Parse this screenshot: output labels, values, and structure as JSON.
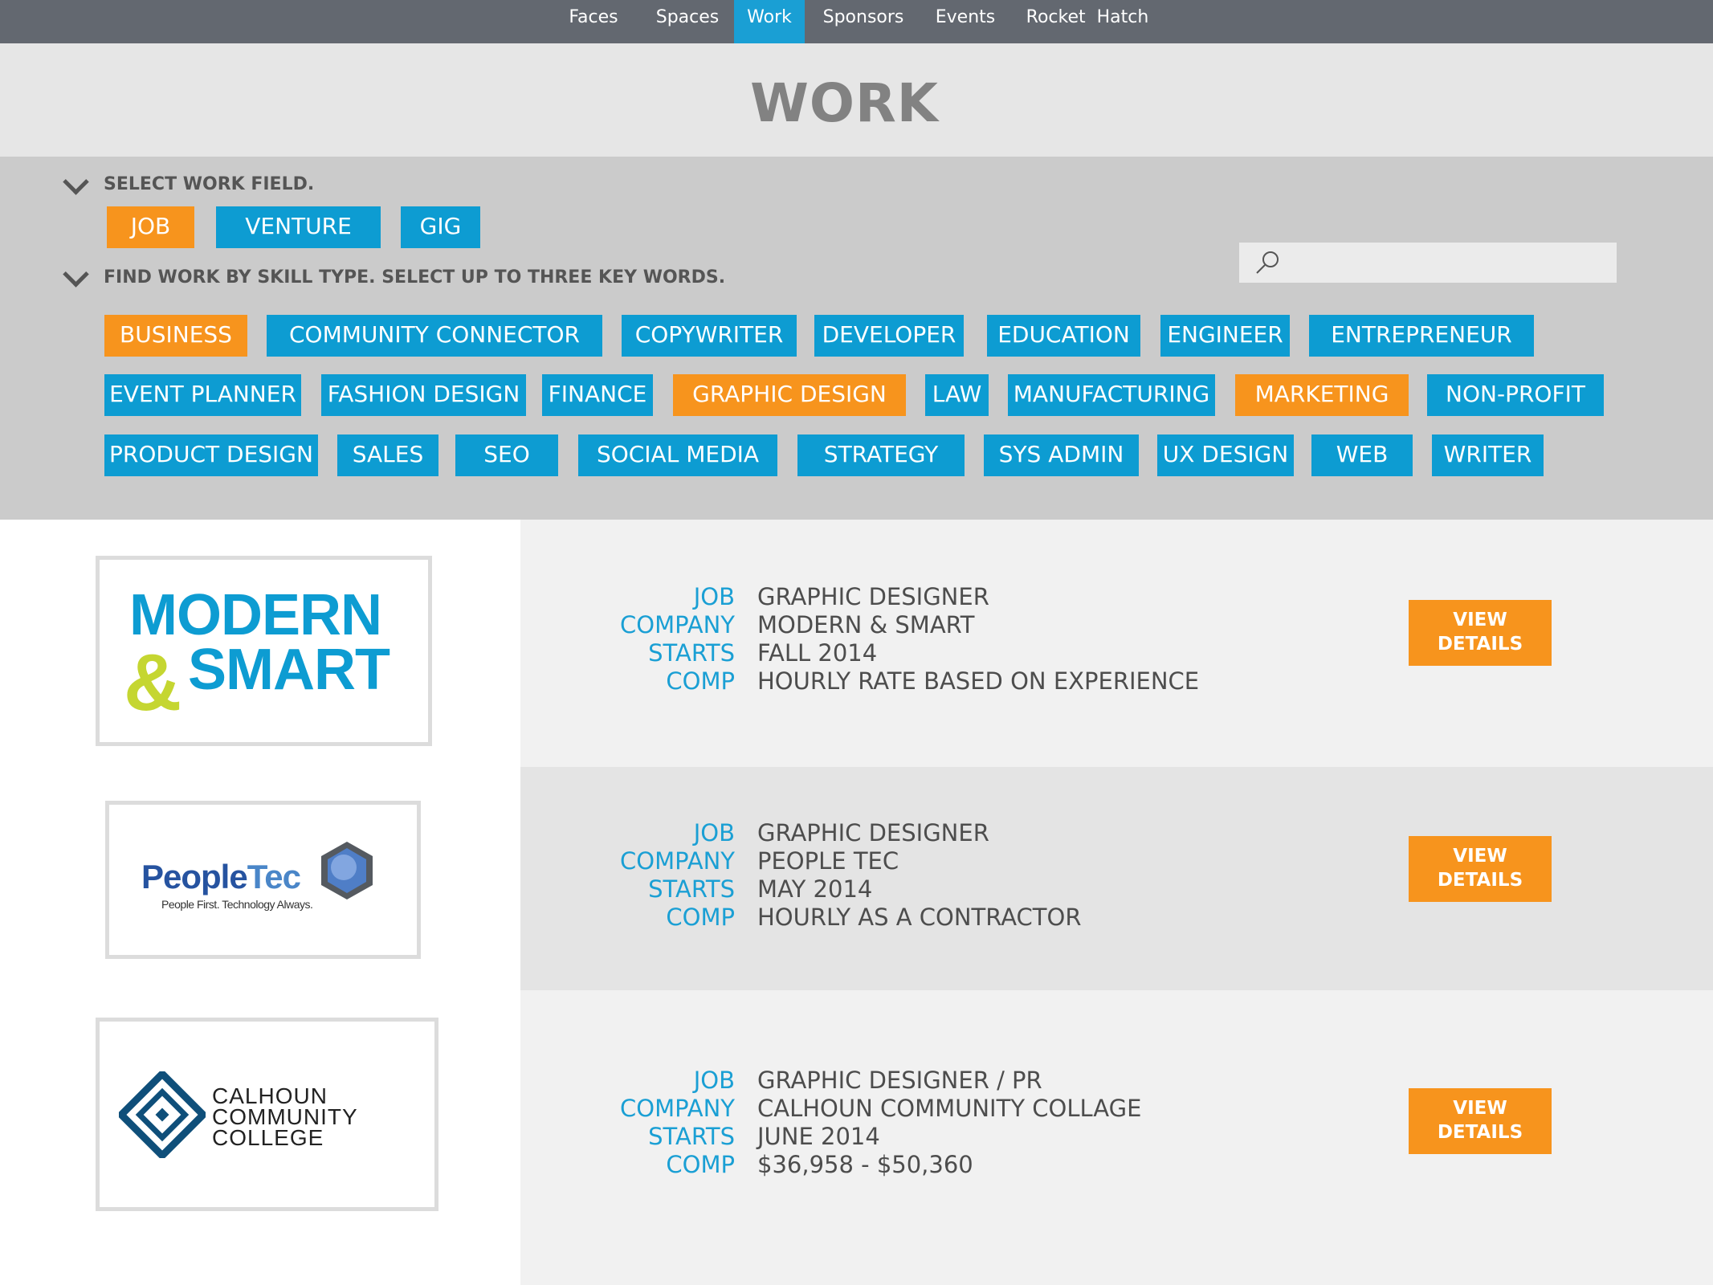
{
  "nav": {
    "items": [
      {
        "label": "Faces"
      },
      {
        "label": "Spaces"
      },
      {
        "label": "Work",
        "active": true
      },
      {
        "label": "Sponsors"
      },
      {
        "label": "Events"
      },
      {
        "label": "Rocket  Hatch"
      }
    ]
  },
  "page": {
    "title": "WORK"
  },
  "filters": {
    "field_label": "SELECT WORK FIELD.",
    "field_options": [
      {
        "label": "JOB",
        "selected": true
      },
      {
        "label": "VENTURE",
        "selected": false
      },
      {
        "label": "GIG",
        "selected": false
      }
    ],
    "skill_label": "FIND WORK BY SKILL TYPE. SELECT UP TO THREE KEY WORDS.",
    "search": {
      "placeholder": "",
      "value": ""
    },
    "skills": [
      {
        "label": "BUSINESS",
        "selected": true
      },
      {
        "label": "COMMUNITY CONNECTOR",
        "selected": false
      },
      {
        "label": "COPYWRITER",
        "selected": false
      },
      {
        "label": "DEVELOPER",
        "selected": false
      },
      {
        "label": "EDUCATION",
        "selected": false
      },
      {
        "label": "ENGINEER",
        "selected": false
      },
      {
        "label": "ENTREPRENEUR",
        "selected": false
      },
      {
        "label": "EVENT PLANNER",
        "selected": false
      },
      {
        "label": "FASHION DESIGN",
        "selected": false
      },
      {
        "label": "FINANCE",
        "selected": false
      },
      {
        "label": "GRAPHIC DESIGN",
        "selected": true
      },
      {
        "label": "LAW",
        "selected": false
      },
      {
        "label": "MANUFACTURING",
        "selected": false
      },
      {
        "label": "MARKETING",
        "selected": true
      },
      {
        "label": "NON-PROFIT",
        "selected": false
      },
      {
        "label": "PRODUCT DESIGN",
        "selected": false
      },
      {
        "label": "SALES",
        "selected": false
      },
      {
        "label": "SEO",
        "selected": false
      },
      {
        "label": "SOCIAL MEDIA",
        "selected": false
      },
      {
        "label": "STRATEGY",
        "selected": false
      },
      {
        "label": "SYS ADMIN",
        "selected": false
      },
      {
        "label": "UX DESIGN",
        "selected": false
      },
      {
        "label": "WEB",
        "selected": false
      },
      {
        "label": "WRITER",
        "selected": false
      }
    ]
  },
  "colors": {
    "accent_blue": "#0d9cd2",
    "accent_orange": "#f7941d",
    "nav_bg": "#636870"
  },
  "field_keys": {
    "job": "JOB",
    "company": "COMPANY",
    "starts": "STARTS",
    "comp": "COMP"
  },
  "listings": [
    {
      "logo": {
        "line1": "MODERN",
        "amp": "&",
        "line2": "SMART"
      },
      "job": "GRAPHIC DESIGNER",
      "company": "MODERN & SMART",
      "starts": "FALL 2014",
      "comp": "HOURLY RATE BASED ON EXPERIENCE",
      "button": {
        "line1": "VIEW",
        "line2": "DETAILS"
      }
    },
    {
      "logo": {
        "name_a": "People",
        "name_b": "Tec",
        "tagline": "People First. Technology Always."
      },
      "job": "GRAPHIC DESIGNER",
      "company": "PEOPLE TEC",
      "starts": "MAY 2014",
      "comp": "HOURLY AS A CONTRACTOR",
      "button": {
        "line1": "VIEW",
        "line2": "DETAILS"
      }
    },
    {
      "logo": {
        "line1": "CALHOUN",
        "line2": "COMMUNITY",
        "line3": "COLLEGE"
      },
      "job": "GRAPHIC DESIGNER / PR",
      "company": "CALHOUN COMMUNITY COLLAGE",
      "starts": "JUNE 2014",
      "comp": "$36,958 - $50,360",
      "button": {
        "line1": "VIEW",
        "line2": "DETAILS"
      }
    }
  ]
}
